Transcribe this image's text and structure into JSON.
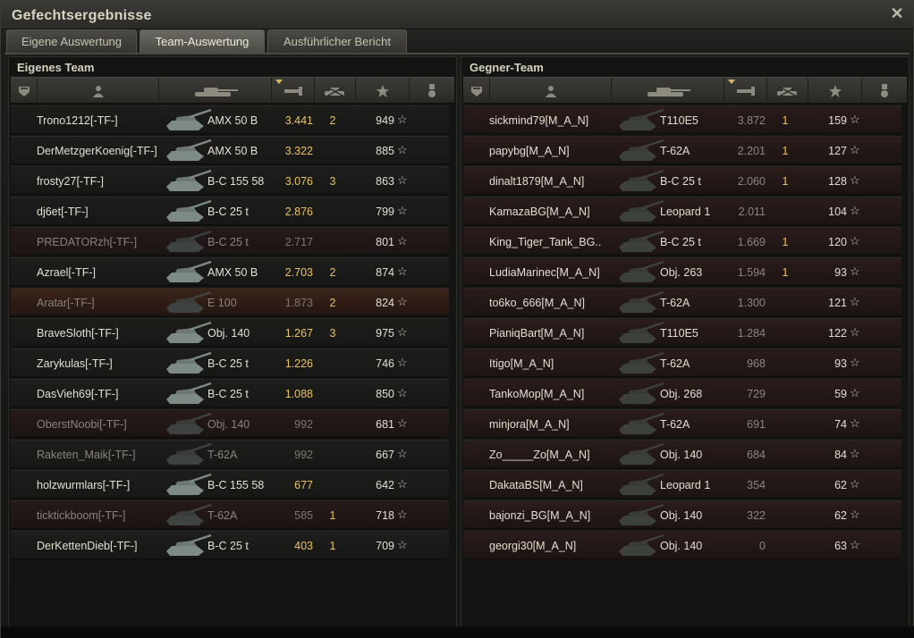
{
  "window": {
    "title": "Gefechtsergebnisse",
    "close_icon": "close-icon"
  },
  "tabs": [
    {
      "label": "Eigene Auswertung",
      "active": false
    },
    {
      "label": "Team-Auswertung",
      "active": true
    },
    {
      "label": "Ausführlicher Bericht",
      "active": false
    }
  ],
  "own_team": {
    "title": "Eigenes Team",
    "columns": [
      "squad-icon",
      "player-icon",
      "tank-icon",
      "damage-icon",
      "kills-icon",
      "score-star-icon",
      "medal-icon"
    ],
    "rows": [
      {
        "name": "Trono1212[-TF-]",
        "vehicle": "AMX 50 B",
        "xp": "3.441",
        "kills": "2",
        "score": "949",
        "state": "alive"
      },
      {
        "name": "DerMetzgerKoenig[-TF-]",
        "vehicle": "AMX 50 B",
        "xp": "3.322",
        "kills": "",
        "score": "885",
        "state": "alive"
      },
      {
        "name": "frosty27[-TF-]",
        "vehicle": "B-C 155 58",
        "xp": "3.076",
        "kills": "3",
        "score": "863",
        "state": "alive"
      },
      {
        "name": "dj6et[-TF-]",
        "vehicle": "B-C 25 t",
        "xp": "2.876",
        "kills": "",
        "score": "799",
        "state": "alive"
      },
      {
        "name": "PREDATORzh[-TF-]",
        "vehicle": "B-C 25 t",
        "xp": "2.717",
        "kills": "",
        "score": "801",
        "state": "dead"
      },
      {
        "name": "Azrael[-TF-]",
        "vehicle": "AMX 50 B",
        "xp": "2.703",
        "kills": "2",
        "score": "874",
        "state": "alive"
      },
      {
        "name": "Aratar[-TF-]",
        "vehicle": "E 100",
        "xp": "1.873",
        "kills": "2",
        "score": "824",
        "state": "highlight"
      },
      {
        "name": "BraveSloth[-TF-]",
        "vehicle": "Obj. 140",
        "xp": "1.267",
        "kills": "3",
        "score": "975",
        "state": "alive"
      },
      {
        "name": "Zarykulas[-TF-]",
        "vehicle": "B-C 25 t",
        "xp": "1.226",
        "kills": "",
        "score": "746",
        "state": "alive"
      },
      {
        "name": "DasVieh69[-TF-]",
        "vehicle": "B-C 25 t",
        "xp": "1.088",
        "kills": "",
        "score": "850",
        "state": "alive"
      },
      {
        "name": "OberstNoobi[-TF-]",
        "vehicle": "Obj. 140",
        "xp": "992",
        "kills": "",
        "score": "681",
        "state": "dead"
      },
      {
        "name": "Raketen_Maik[-TF-]",
        "vehicle": "T-62A",
        "xp": "992",
        "kills": "",
        "score": "667",
        "state": "faded"
      },
      {
        "name": "holzwurmlars[-TF-]",
        "vehicle": "B-C 155 58",
        "xp": "677",
        "kills": "",
        "score": "642",
        "state": "alive"
      },
      {
        "name": "ticktickboom[-TF-]",
        "vehicle": "T-62A",
        "xp": "585",
        "kills": "1",
        "score": "718",
        "state": "dead"
      },
      {
        "name": "DerKettenDieb[-TF-]",
        "vehicle": "B-C 25 t",
        "xp": "403",
        "kills": "1",
        "score": "709",
        "state": "alive"
      }
    ]
  },
  "enemy_team": {
    "title": "Gegner-Team",
    "rows": [
      {
        "name": "sickmind79[M_A_N]",
        "vehicle": "T110E5",
        "xp": "3.872",
        "kills": "1",
        "score": "159"
      },
      {
        "name": "papybg[M_A_N]",
        "vehicle": "T-62A",
        "xp": "2.201",
        "kills": "1",
        "score": "127"
      },
      {
        "name": "dinalt1879[M_A_N]",
        "vehicle": "B-C 25 t",
        "xp": "2.060",
        "kills": "1",
        "score": "128"
      },
      {
        "name": "KamazaBG[M_A_N]",
        "vehicle": "Leopard 1",
        "xp": "2.011",
        "kills": "",
        "score": "104"
      },
      {
        "name": "King_Tiger_Tank_BG..",
        "vehicle": "B-C 25 t",
        "xp": "1.669",
        "kills": "1",
        "score": "120"
      },
      {
        "name": "LudiaMarinec[M_A_N]",
        "vehicle": "Obj. 263",
        "xp": "1.594",
        "kills": "1",
        "score": "93"
      },
      {
        "name": "to6ko_666[M_A_N]",
        "vehicle": "T-62A",
        "xp": "1.300",
        "kills": "",
        "score": "121"
      },
      {
        "name": "PianiqBart[M_A_N]",
        "vehicle": "T110E5",
        "xp": "1.284",
        "kills": "",
        "score": "122"
      },
      {
        "name": "Itigo[M_A_N]",
        "vehicle": "T-62A",
        "xp": "968",
        "kills": "",
        "score": "93"
      },
      {
        "name": "TankoMop[M_A_N]",
        "vehicle": "Obj. 268",
        "xp": "729",
        "kills": "",
        "score": "59"
      },
      {
        "name": "minjora[M_A_N]",
        "vehicle": "T-62A",
        "xp": "691",
        "kills": "",
        "score": "74"
      },
      {
        "name": "Zo_____Zo[M_A_N]",
        "vehicle": "Obj. 140",
        "xp": "684",
        "kills": "",
        "score": "84"
      },
      {
        "name": "DakataBS[M_A_N]",
        "vehicle": "Leopard 1",
        "xp": "354",
        "kills": "",
        "score": "62"
      },
      {
        "name": "bajonzi_BG[M_A_N]",
        "vehicle": "Obj. 140",
        "xp": "322",
        "kills": "",
        "score": "62"
      },
      {
        "name": "georgi30[M_A_N]",
        "vehicle": "Obj. 140",
        "xp": "0",
        "kills": "",
        "score": "63"
      }
    ]
  },
  "colors": {
    "xp_gold": "#e9c267",
    "dead_row": "#261a19",
    "highlight_row": "#3a2418"
  }
}
